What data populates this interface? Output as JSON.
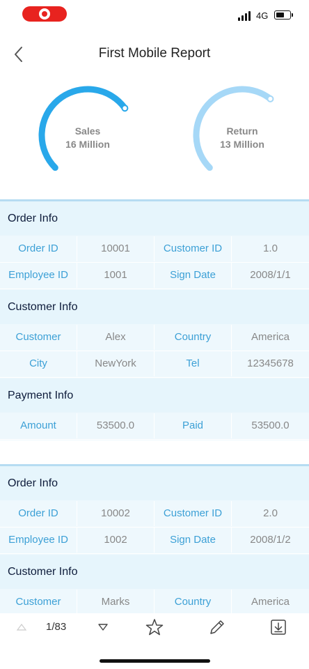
{
  "status": {
    "network": "4G",
    "recording_color": "#e8231f"
  },
  "header": {
    "title": "First Mobile Report",
    "back_icon": "chevron-left-icon"
  },
  "gauges": [
    {
      "name": "Sales",
      "value": "16 Million",
      "fill_fraction": 0.7,
      "color": "#29a8ea"
    },
    {
      "name": "Return",
      "value": "13 Million",
      "fill_fraction": 0.64,
      "color": "#a6d8f7"
    }
  ],
  "records": [
    {
      "order_info": {
        "title": "Order Info",
        "rows": [
          [
            "Order ID",
            "10001",
            "Customer ID",
            "1.0"
          ],
          [
            "Employee ID",
            "1001",
            "Sign Date",
            "2008/1/1"
          ]
        ]
      },
      "customer_info": {
        "title": "Customer Info",
        "rows": [
          [
            "Customer",
            "Alex",
            "Country",
            "America"
          ],
          [
            "City",
            "NewYork",
            "Tel",
            "12345678"
          ]
        ]
      },
      "payment_info": {
        "title": "Payment Info",
        "rows": [
          [
            "Amount",
            "53500.0",
            "Paid",
            "53500.0"
          ]
        ]
      }
    },
    {
      "order_info": {
        "title": "Order Info",
        "rows": [
          [
            "Order ID",
            "10002",
            "Customer ID",
            "2.0"
          ],
          [
            "Employee ID",
            "1002",
            "Sign Date",
            "2008/1/2"
          ]
        ]
      },
      "customer_info": {
        "title": "Customer Info",
        "rows": [
          [
            "Customer",
            "Marks",
            "Country",
            "America"
          ]
        ]
      }
    }
  ],
  "toolbar": {
    "page_indicator": "1/83",
    "icons": [
      "prev-page-icon",
      "next-page-icon",
      "star-icon",
      "pencil-icon",
      "download-icon"
    ]
  },
  "colors": {
    "section_bg": "#e6f5fc",
    "row_bg": "#eef8fd",
    "label_text": "#3ca0d6",
    "value_text": "#888888",
    "section_title": "#0d1b3a"
  }
}
